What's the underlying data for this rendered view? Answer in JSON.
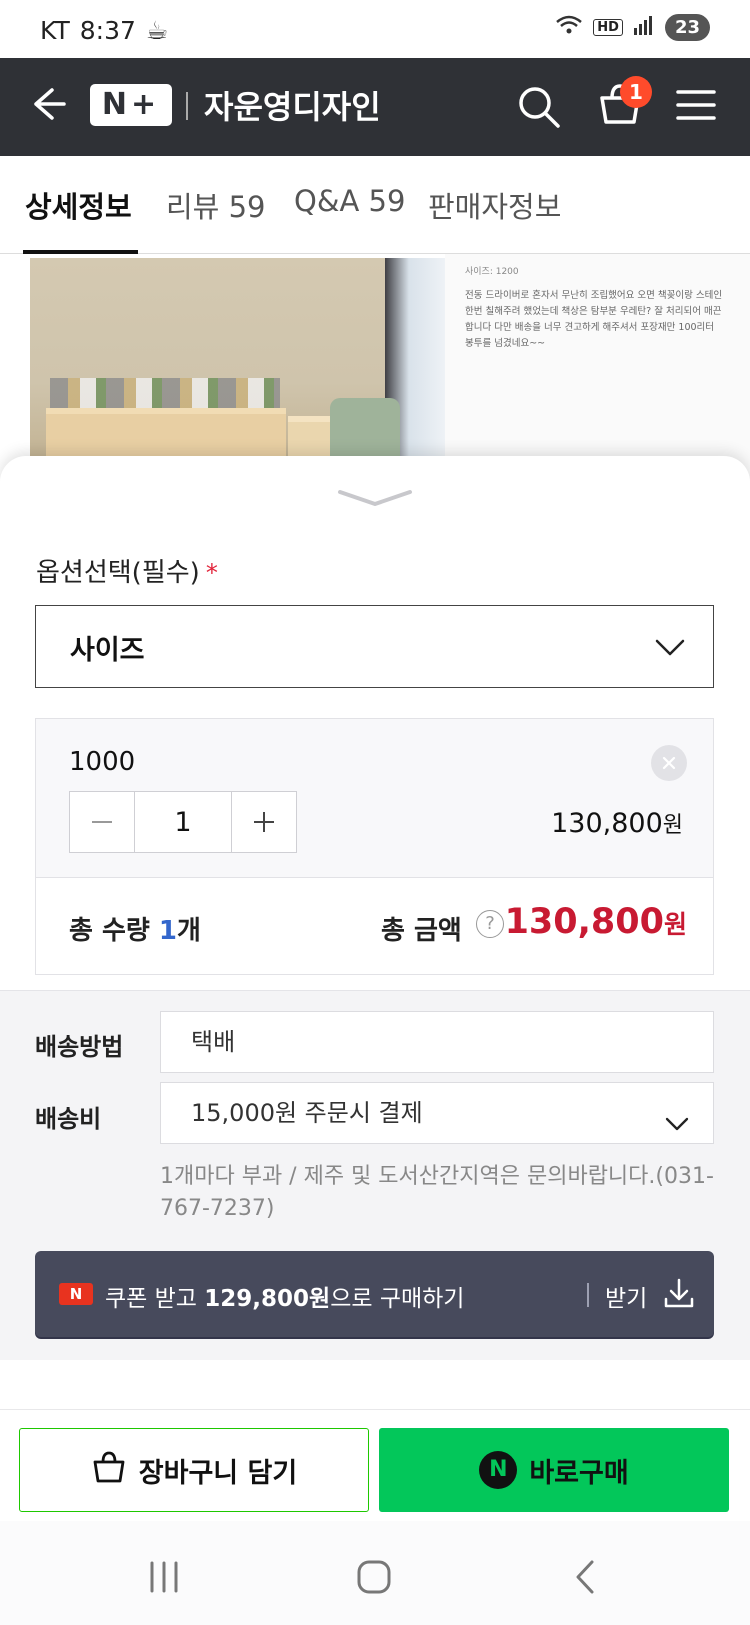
{
  "status_bar": {
    "carrier": "KT",
    "time": "8:37",
    "battery": "23"
  },
  "header": {
    "store_name": "자운영디자인",
    "cart_count": "1"
  },
  "tabs": [
    {
      "label": "상세정보"
    },
    {
      "label": "리뷰 59"
    },
    {
      "label": "Q&A 59"
    },
    {
      "label": "판매자정보"
    }
  ],
  "content": {
    "note_size": "사이즈: 1200",
    "note_text": "전동 드라이버로 혼자서 무난히 조립했어요 오면 책꽂이랑 스테인 한번 칠해주려 했었는데 책상은 탐부분 우레탄? 잘 처리되어 매끈합니다 다만 배송을 너무 견고하게 해주셔서 포장재만 100리터 봉투를 넘겼네요~~"
  },
  "sheet": {
    "option_title": "옵션선택(필수)",
    "required_mark": "*",
    "select_label": "사이즈",
    "selected_option": {
      "name": "1000",
      "quantity": "1",
      "price": "130,800",
      "price_unit": "원"
    },
    "total": {
      "qty_label": "총 수량",
      "qty_value": "1",
      "qty_unit": "개",
      "amount_label": "총 금액",
      "amount": "130,800",
      "amount_unit": "원"
    },
    "shipping": {
      "method_label": "배송방법",
      "method_value": "택배",
      "fee_label": "배송비",
      "fee_value": "15,000원 주문시 결제",
      "note": "1개마다 부과 / 제주 및 도서산간지역은 문의바랍니다.(031-767-7237)"
    },
    "coupon": {
      "badge": "N",
      "text_prefix": "쿠폰 받고 ",
      "text_amount": "129,800원",
      "text_suffix": "으로 구매하기",
      "get_label": "받기"
    }
  },
  "actions": {
    "cart_label": "장바구니 담기",
    "buy_label": "바로구매",
    "npay_badge": "N"
  },
  "colors": {
    "header_bg": "#2f3136",
    "accent_red": "#c81a32",
    "buy_green": "#03c75a",
    "coupon_bg": "#474a5c"
  }
}
